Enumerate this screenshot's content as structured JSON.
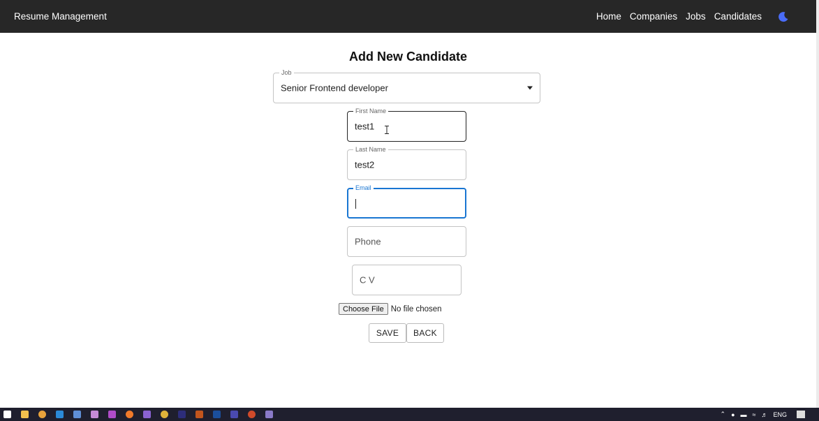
{
  "app": {
    "title": "Resume Management"
  },
  "nav": {
    "items": [
      "Home",
      "Companies",
      "Jobs",
      "Candidates"
    ],
    "theme_icon": "moon-icon"
  },
  "form": {
    "title": "Add New Candidate",
    "job": {
      "label": "Job",
      "value": "Senior Frontend developer"
    },
    "first_name": {
      "label": "First Name",
      "value": "test1"
    },
    "last_name": {
      "label": "Last Name",
      "value": "test2"
    },
    "email": {
      "label": "Email",
      "value": ""
    },
    "phone": {
      "placeholder": "Phone"
    },
    "cv": {
      "placeholder": "C V"
    },
    "file": {
      "button_label": "Choose File",
      "status": "No file chosen"
    },
    "save_label": "SAVE",
    "back_label": "BACK"
  },
  "taskbar": {
    "language": "ENG"
  },
  "colors": {
    "appbar": "#272727",
    "accent": "#1976d2",
    "theme_icon": "#4a6cf7"
  }
}
